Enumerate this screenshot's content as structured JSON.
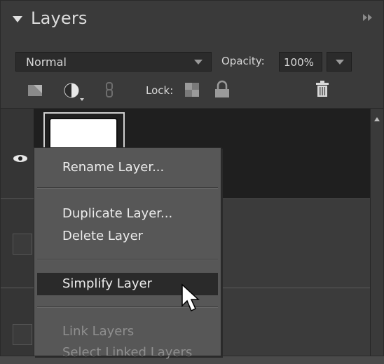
{
  "panel": {
    "title": "Layers"
  },
  "controls": {
    "blend_mode": "Normal",
    "opacity_label": "Opacity:",
    "opacity_value": "100%",
    "lock_label": "Lock:"
  },
  "context_menu": {
    "items": [
      {
        "label": "Rename Layer...",
        "state": "normal"
      },
      {
        "label": "Duplicate Layer...",
        "state": "normal"
      },
      {
        "label": "Delete Layer",
        "state": "normal"
      },
      {
        "label": "Simplify Layer",
        "state": "highlighted"
      },
      {
        "label": "Link Layers",
        "state": "disabled"
      },
      {
        "label": "Select Linked Layers",
        "state": "disabled"
      }
    ]
  },
  "icons": {
    "collapse": "collapse-triangle-icon",
    "panel_menu": "panel-menu-icon",
    "new_layer": "new-layer-icon",
    "adjustment": "adjustment-layer-icon",
    "link": "link-icon",
    "lock_transparency": "lock-transparency-icon",
    "lock_all": "lock-icon",
    "delete": "trash-icon",
    "visibility": "eye-icon"
  },
  "colors": {
    "highlight": "#2a2a2a",
    "menu_bg": "#575757",
    "selected_layer_bg": "#1f1f1f"
  }
}
